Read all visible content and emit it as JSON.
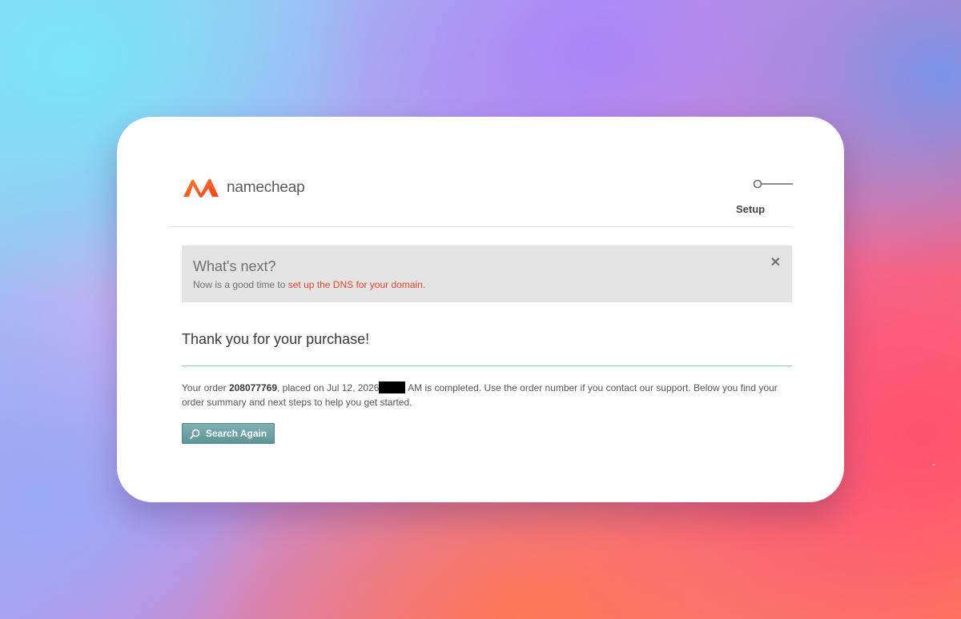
{
  "header": {
    "logo_text": "namecheap",
    "step_label": "Setup"
  },
  "notice": {
    "title": "What's next?",
    "text_prefix": "Now is a good time to ",
    "link_text": "set up the DNS for your domain.",
    "close_glyph": "✕"
  },
  "main": {
    "thanks_title": "Thank you for your purchase!",
    "order_prefix": "Your order ",
    "order_number": "208077769",
    "order_placed": ", placed on Jul 12, 2026",
    "order_suffix": " AM is completed. Use the order number if you contact our support. Below you find your order summary and next steps to help you get started.",
    "search_button_label": "Search Again"
  },
  "colors": {
    "brand_orange": "#f15a22",
    "link_red": "#e0452c",
    "button_teal": "#6fa2a4",
    "notice_bg": "#e3e3e3"
  }
}
